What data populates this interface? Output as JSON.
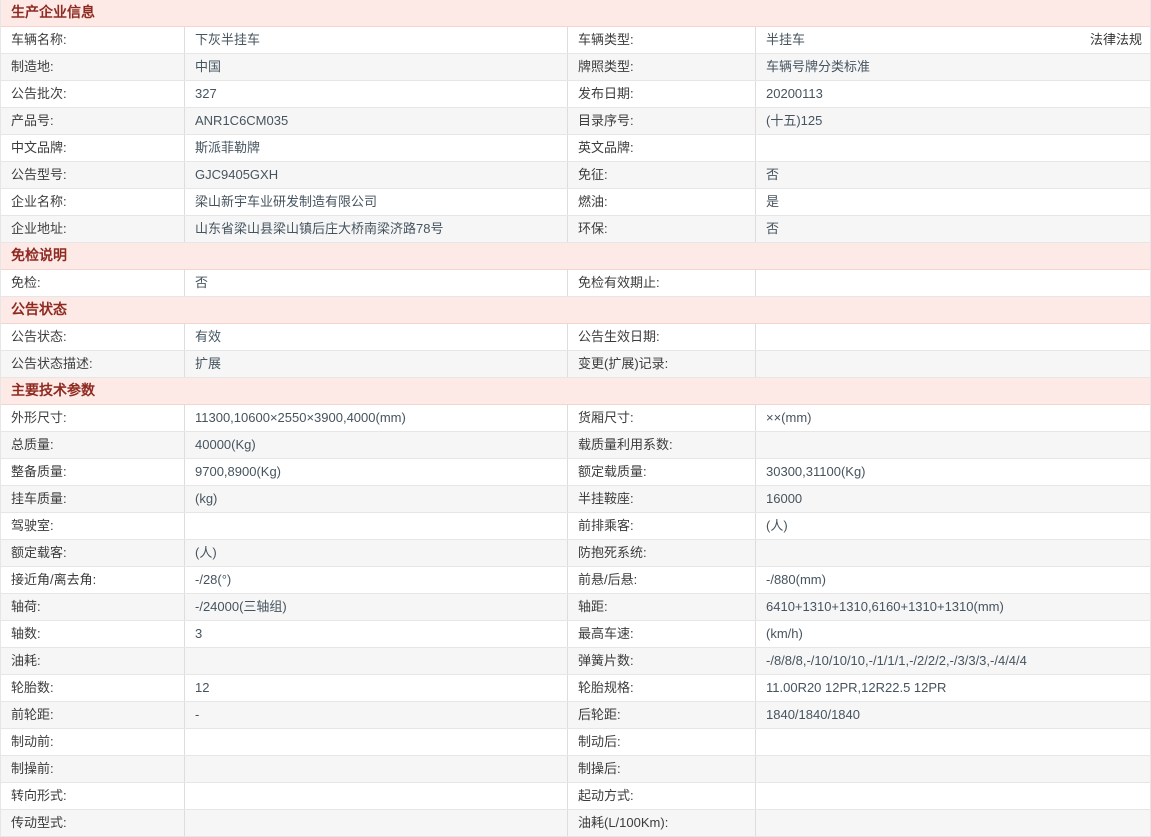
{
  "colors": {
    "section_header_bg": "#fdeae7",
    "section_header_text": "#8f2a21",
    "row_alt_bg": "#f6f6f6",
    "label_text": "#3c3c3c",
    "value_text": "#46545f"
  },
  "legal_link": "法律法规",
  "sections": [
    {
      "title": "生产企业信息",
      "rows": [
        {
          "l1": "车辆名称:",
          "v1": "下灰半挂车",
          "l2": "车辆类型:",
          "v2": "半挂车",
          "extra": "法律法规"
        },
        {
          "l1": "制造地:",
          "v1": "中国",
          "l2": "牌照类型:",
          "v2": "车辆号牌分类标准"
        },
        {
          "l1": "公告批次:",
          "v1": "327",
          "l2": "发布日期:",
          "v2": "20200113"
        },
        {
          "l1": "产品号:",
          "v1": "ANR1C6CM035",
          "l2": "目录序号:",
          "v2": "(十五)125"
        },
        {
          "l1": "中文品牌:",
          "v1": "斯派菲勒牌",
          "l2": "英文品牌:",
          "v2": ""
        },
        {
          "l1": "公告型号:",
          "v1": "GJC9405GXH",
          "l2": "免征:",
          "v2": "否"
        },
        {
          "l1": "企业名称:",
          "v1": "梁山新宇车业研发制造有限公司",
          "l2": "燃油:",
          "v2": "是"
        },
        {
          "l1": "企业地址:",
          "v1": "山东省梁山县梁山镇后庄大桥南梁济路78号",
          "l2": "环保:",
          "v2": "否"
        }
      ]
    },
    {
      "title": "免检说明",
      "rows": [
        {
          "l1": "免检:",
          "v1": "否",
          "l2": "免检有效期止:",
          "v2": ""
        }
      ]
    },
    {
      "title": "公告状态",
      "rows": [
        {
          "l1": "公告状态:",
          "v1": "有效",
          "l2": "公告生效日期:",
          "v2": ""
        },
        {
          "l1": "公告状态描述:",
          "v1": "扩展",
          "l2": "变更(扩展)记录:",
          "v2": ""
        }
      ]
    },
    {
      "title": "主要技术参数",
      "rows": [
        {
          "l1": "外形尺寸:",
          "v1": "11300,10600×2550×3900,4000(mm)",
          "l2": "货厢尺寸:",
          "v2": "××(mm)"
        },
        {
          "l1": "总质量:",
          "v1": "40000(Kg)",
          "l2": "载质量利用系数:",
          "v2": ""
        },
        {
          "l1": "整备质量:",
          "v1": "9700,8900(Kg)",
          "l2": "额定载质量:",
          "v2": "30300,31100(Kg)"
        },
        {
          "l1": "挂车质量:",
          "v1": "(kg)",
          "l2": "半挂鞍座:",
          "v2": "16000"
        },
        {
          "l1": "驾驶室:",
          "v1": "",
          "l2": "前排乘客:",
          "v2": "(人)"
        },
        {
          "l1": "额定载客:",
          "v1": "(人)",
          "l2": "防抱死系统:",
          "v2": ""
        },
        {
          "l1": "接近角/离去角:",
          "v1": "-/28(°)",
          "l2": "前悬/后悬:",
          "v2": "-/880(mm)"
        },
        {
          "l1": "轴荷:",
          "v1": "-/24000(三轴组)",
          "l2": "轴距:",
          "v2": "6410+1310+1310,6160+1310+1310(mm)"
        },
        {
          "l1": "轴数:",
          "v1": "3",
          "l2": "最高车速:",
          "v2": "(km/h)"
        },
        {
          "l1": "油耗:",
          "v1": "",
          "l2": "弹簧片数:",
          "v2": "-/8/8/8,-/10/10/10,-/1/1/1,-/2/2/2,-/3/3/3,-/4/4/4"
        },
        {
          "l1": "轮胎数:",
          "v1": "12",
          "l2": "轮胎规格:",
          "v2": "11.00R20 12PR,12R22.5 12PR"
        },
        {
          "l1": "前轮距:",
          "v1": "-",
          "l2": "后轮距:",
          "v2": "1840/1840/1840"
        },
        {
          "l1": "制动前:",
          "v1": "",
          "l2": "制动后:",
          "v2": ""
        },
        {
          "l1": "制操前:",
          "v1": "",
          "l2": "制操后:",
          "v2": ""
        },
        {
          "l1": "转向形式:",
          "v1": "",
          "l2": "起动方式:",
          "v2": ""
        },
        {
          "l1": "传动型式:",
          "v1": "",
          "l2": "油耗(L/100Km):",
          "v2": ""
        }
      ]
    }
  ]
}
